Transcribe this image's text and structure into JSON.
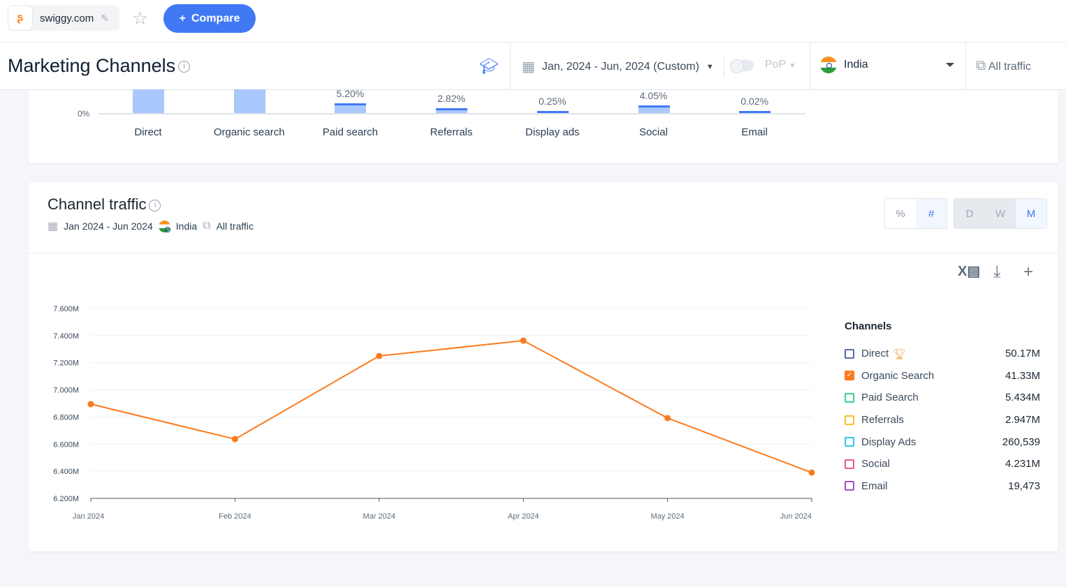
{
  "topbar": {
    "site": "swiggy.com",
    "compare_label": "Compare"
  },
  "header": {
    "title": "Marketing Channels",
    "date_range": "Jan, 2024 - Jun, 2024 (Custom)",
    "pop_label": "PoP",
    "country": "India",
    "traffic": "All traffic"
  },
  "overview": {
    "zero_label": "0%",
    "channels": [
      {
        "name": "Direct",
        "pct": ""
      },
      {
        "name": "Organic search",
        "pct": ""
      },
      {
        "name": "Paid search",
        "pct": "5.20%"
      },
      {
        "name": "Referrals",
        "pct": "2.82%"
      },
      {
        "name": "Display ads",
        "pct": "0.25%"
      },
      {
        "name": "Social",
        "pct": "4.05%"
      },
      {
        "name": "Email",
        "pct": "0.02%"
      }
    ]
  },
  "channel_traffic": {
    "title": "Channel traffic",
    "date": "Jan 2024 - Jun 2024",
    "country": "India",
    "traffic": "All traffic",
    "metric_toggle": [
      "%",
      "#"
    ],
    "metric_selected": "#",
    "granularity": [
      "D",
      "W",
      "M"
    ],
    "granularity_selected": "M",
    "legend_title": "Channels",
    "legend": [
      {
        "name": "Direct",
        "value": "50.17M",
        "color": "#5a6aa8",
        "checked": false,
        "trophy": true
      },
      {
        "name": "Organic Search",
        "value": "41.33M",
        "color": "#fb7a1e",
        "checked": true
      },
      {
        "name": "Paid Search",
        "value": "5.434M",
        "color": "#3ccf91",
        "checked": false
      },
      {
        "name": "Referrals",
        "value": "2.947M",
        "color": "#fcbf2a",
        "checked": false
      },
      {
        "name": "Display Ads",
        "value": "260,539",
        "color": "#33c4ea",
        "checked": false
      },
      {
        "name": "Social",
        "value": "4.231M",
        "color": "#ea5b82",
        "checked": false
      },
      {
        "name": "Email",
        "value": "19,473",
        "color": "#a64fc2",
        "checked": false
      }
    ]
  },
  "chart_data": {
    "type": "line",
    "categories": [
      "Jan 2024",
      "Feb 2024",
      "Mar 2024",
      "Apr 2024",
      "May 2024",
      "Jun 2024"
    ],
    "series": [
      {
        "name": "Organic Search",
        "color": "#fb7a1e",
        "values": [
          6.895,
          6.637,
          7.25,
          7.363,
          6.792,
          6.39
        ]
      }
    ],
    "unit": "M",
    "ylim": [
      6.2,
      7.6
    ],
    "yticks": [
      "6.200M",
      "6.400M",
      "6.600M",
      "6.800M",
      "7.000M",
      "7.200M",
      "7.400M",
      "7.600M"
    ],
    "grid": true
  }
}
